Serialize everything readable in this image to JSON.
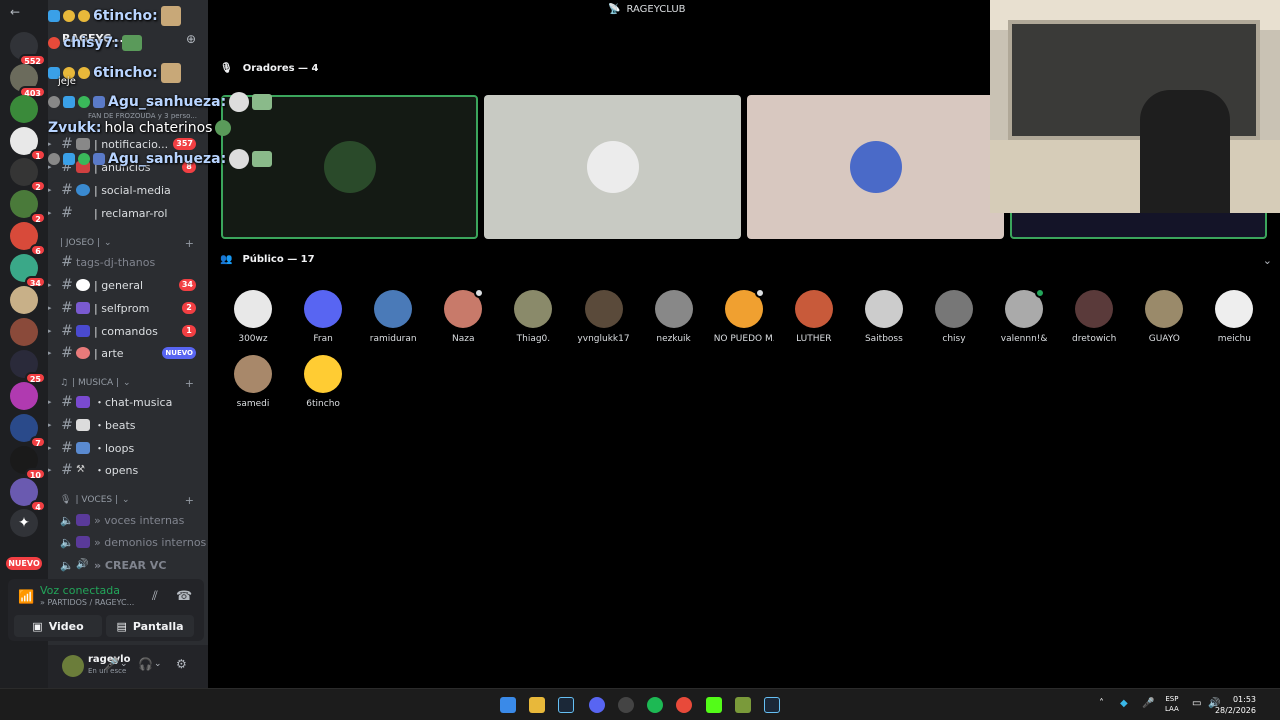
{
  "window": {
    "title": "RAGEYCLUB"
  },
  "server": {
    "name": "RAGEYC..."
  },
  "rail_badges": [
    "552",
    "403",
    "1",
    "2",
    "2",
    "6",
    "34",
    "25",
    "7",
    "10",
    "4"
  ],
  "rail_new": "NUEVO",
  "channels_top": [
    {
      "name": "| notificacio...",
      "badge": "357"
    },
    {
      "name": "| anuncios",
      "badge": "8"
    },
    {
      "name": "| social-media",
      "badge": ""
    },
    {
      "name": "| reclamar-rol",
      "badge": ""
    }
  ],
  "category_joseo": "| JOSEO |",
  "channels_joseo": [
    {
      "name": "tags-dj-thanos",
      "badge": ""
    },
    {
      "name": "| general",
      "badge": "34"
    },
    {
      "name": "| selfprom",
      "badge": "2"
    },
    {
      "name": "| comandos",
      "badge": "1"
    },
    {
      "name": "| arte",
      "badge": "NUEVO"
    }
  ],
  "category_musica": "| MUSICA |",
  "channels_musica": [
    {
      "name": "・chat-musica"
    },
    {
      "name": "・beats"
    },
    {
      "name": "・loops"
    },
    {
      "name": "・opens"
    }
  ],
  "category_voces": "| VOCES |",
  "voice_channels": [
    {
      "name": "» voces internas"
    },
    {
      "name": "» demonios internos"
    },
    {
      "name": "» CREAR VC"
    }
  ],
  "voice_panel": {
    "title": "Voz conectada",
    "subtitle": "» PARTIDOS / RAGEYC...",
    "video": "Video",
    "screen": "Pantalla"
  },
  "user": {
    "name": "rageylo",
    "status": "En un esce"
  },
  "stage": {
    "speakers_label": "Oradores — 4",
    "audience_label": "Público — 17"
  },
  "audience": [
    {
      "name": "300wz"
    },
    {
      "name": "Fran"
    },
    {
      "name": "ramiduran"
    },
    {
      "name": "Naza"
    },
    {
      "name": "Thiag0."
    },
    {
      "name": "yvnglukk17"
    },
    {
      "name": "nezkuik"
    },
    {
      "name": "NO PUEDO M..."
    },
    {
      "name": "LUTHER"
    },
    {
      "name": "Saitboss"
    },
    {
      "name": "chisy"
    },
    {
      "name": "valennn!&"
    },
    {
      "name": "dretowich"
    },
    {
      "name": "GUAYO"
    },
    {
      "name": "meichu"
    },
    {
      "name": "samedi"
    },
    {
      "name": "6tincho"
    }
  ],
  "chat": [
    {
      "name": "6tincho:",
      "msg": ""
    },
    {
      "name": "chisy7:",
      "msg": ""
    },
    {
      "name": "6tincho:",
      "msg": ""
    },
    {
      "name": "",
      "msg": "jeje"
    },
    {
      "name": "Agu_sanhueza:",
      "msg": ""
    },
    {
      "name": "Zvukk:",
      "msg": "hola chaterinos"
    },
    {
      "name": "Agu_sanhueza:",
      "msg": ""
    }
  ],
  "sidebar_overlay": {
    "fan_text": "FAN DE FROZOUDA y 3 perso..."
  },
  "taskbar": {
    "lang1": "ESP",
    "lang2": "LAA",
    "time": "01:53",
    "date": "28/2/2026"
  },
  "colors": {
    "accent": "#5865f2",
    "green": "#23a55a",
    "red": "#f23f43"
  }
}
